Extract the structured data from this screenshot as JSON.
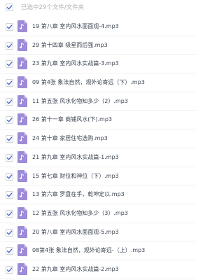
{
  "selection": {
    "summary": "已选中29个文件/文件夹",
    "all_checked": true
  },
  "files": [
    {
      "name": "19 第八章 室内风水面面观-4.mp3",
      "checked": true,
      "icon": "audio-file-icon"
    },
    {
      "name": "29 第十四章 吸星而后强.mp3",
      "checked": true,
      "icon": "audio-file-icon"
    },
    {
      "name": "23 第九章 室内风水实战篇-3.mp3",
      "checked": true,
      "icon": "audio-file-icon"
    },
    {
      "name": "09 第4张 象法自然，观外论寄远（下）.mp3",
      "checked": true,
      "icon": "audio-file-icon"
    },
    {
      "name": "11 第五张 风水化物知多少（2）.mp3",
      "checked": true,
      "icon": "audio-file-icon"
    },
    {
      "name": "26 第十一章 商铺风水(下).mp3",
      "checked": true,
      "icon": "audio-file-icon"
    },
    {
      "name": "24 第十章 家居住宅选购.mp3",
      "checked": true,
      "icon": "audio-file-icon"
    },
    {
      "name": "21 第九章 室内风水实战篇-1.mp3",
      "checked": true,
      "icon": "audio-file-icon"
    },
    {
      "name": "15 第七章 财位和神位（下）.mp3",
      "checked": true,
      "icon": "audio-file-icon"
    },
    {
      "name": "13 第六章 罗盘在手，乾坤定以.mp3",
      "checked": true,
      "icon": "audio-file-icon"
    },
    {
      "name": "12 第五张 风水化物知多少（3）.mp3",
      "checked": true,
      "icon": "audio-file-icon"
    },
    {
      "name": "20 第八章 室内风水面面观-5.mp3",
      "checked": true,
      "icon": "audio-file-icon"
    },
    {
      "name": "08第4张 象法自然，观外论寄远-（上）.mp3",
      "checked": true,
      "icon": "audio-file-icon"
    },
    {
      "name": "22 第九章 室内风水实战篇-2.mp3",
      "checked": true,
      "icon": "audio-file-icon"
    }
  ],
  "colors": {
    "icon_purple": "#9d8bd8",
    "check_blue": "#4a6fd3",
    "text": "#3b4350",
    "muted": "#b0b3b8"
  }
}
